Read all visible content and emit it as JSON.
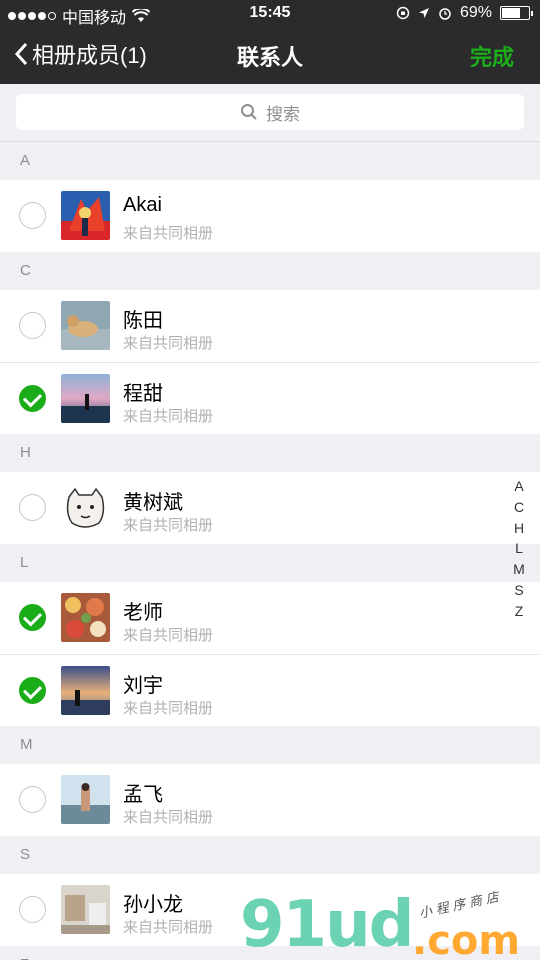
{
  "status_bar": {
    "carrier": "中国移动",
    "time": "15:45",
    "battery": "69%",
    "battery_level": 0.69
  },
  "nav": {
    "back_label": "相册成员(1)",
    "title": "联系人",
    "done_label": "完成"
  },
  "search": {
    "placeholder": "搜索"
  },
  "sections": [
    {
      "letter": "A",
      "contacts": [
        {
          "name": "Akai",
          "subtitle": "来自共同相册",
          "checked": false,
          "avatar": "colorful-figure"
        }
      ]
    },
    {
      "letter": "C",
      "contacts": [
        {
          "name": "陈田",
          "subtitle": "来自共同相册",
          "checked": false,
          "avatar": "dog-photo"
        },
        {
          "name": "程甜",
          "subtitle": "来自共同相册",
          "checked": true,
          "avatar": "sunset-person"
        }
      ]
    },
    {
      "letter": "H",
      "contacts": [
        {
          "name": "黄树斌",
          "subtitle": "来自共同相册",
          "checked": false,
          "avatar": "cartoon-face"
        }
      ]
    },
    {
      "letter": "L",
      "contacts": [
        {
          "name": "老师",
          "subtitle": "来自共同相册",
          "checked": true,
          "avatar": "food-photo"
        },
        {
          "name": "刘宇",
          "subtitle": "来自共同相册",
          "checked": true,
          "avatar": "beach-silhouette"
        }
      ]
    },
    {
      "letter": "M",
      "contacts": [
        {
          "name": "孟飞",
          "subtitle": "来自共同相册",
          "checked": false,
          "avatar": "beach-person"
        }
      ]
    },
    {
      "letter": "S",
      "contacts": [
        {
          "name": "孙小龙",
          "subtitle": "来自共同相册",
          "checked": false,
          "avatar": "room-photo"
        }
      ]
    },
    {
      "letter": "Z",
      "contacts": []
    }
  ],
  "index_letters": [
    "A",
    "C",
    "H",
    "L",
    "M",
    "S",
    "Z"
  ],
  "watermark": {
    "brand": "91ud",
    "domain": ".com",
    "tagline": "小程序商店"
  },
  "colors": {
    "accent_green": "#1aad19",
    "nav_bg": "#2b2b2e"
  }
}
